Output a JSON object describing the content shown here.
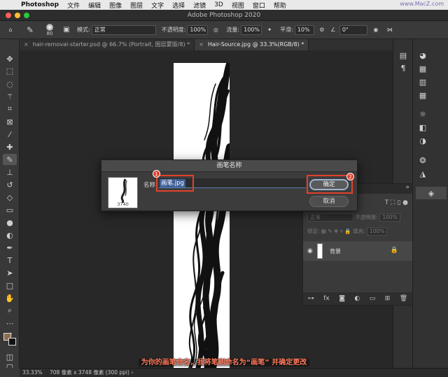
{
  "menubar": {
    "app": "Photoshop",
    "items": [
      "文件",
      "编辑",
      "图像",
      "图层",
      "文字",
      "选择",
      "滤镜",
      "3D",
      "视图",
      "窗口",
      "帮助"
    ],
    "watermark": "www.MacZ.com"
  },
  "window": {
    "title": "Adobe Photoshop 2020"
  },
  "options": {
    "brush_size": "80",
    "mode_label": "模式:",
    "mode_value": "正常",
    "opacity_label": "不透明度:",
    "opacity_value": "100%",
    "flow_label": "流量:",
    "flow_value": "100%",
    "smooth_label": "平滑:",
    "smooth_value": "10%",
    "angle_value": "0°"
  },
  "tabs": [
    {
      "label": "hair-removal-starter.psd @ 66.7% (Portrait, 图层蒙版/8) *"
    },
    {
      "label": "Hair-Source.jpg @ 33.3%(RGB/8) *"
    }
  ],
  "dialog": {
    "title": "画笔名称",
    "name_label": "名称:",
    "name_value": "画笔.jpg",
    "preview_size": "3740",
    "ok_label": "确定",
    "cancel_label": "取消",
    "badge1": "1",
    "badge2": "2"
  },
  "layers": {
    "blend_mode": "正常",
    "opacity_label": "不透明度:",
    "opacity_value": "100%",
    "lock_label": "锁定:",
    "fill_label": "填充:",
    "fill_value": "100%",
    "layer_name": "背景"
  },
  "subtitle": "为你的画笔命名，我将笔刷命名为“画笔” 并确定更改",
  "status": {
    "zoom": "33.33%",
    "doc_info": "708 像素 x 3748 像素 (300 ppi)"
  },
  "colors": {
    "accent_red": "#e2412c",
    "foreground": "#8c6e4e",
    "background_swatch": "#111111"
  }
}
